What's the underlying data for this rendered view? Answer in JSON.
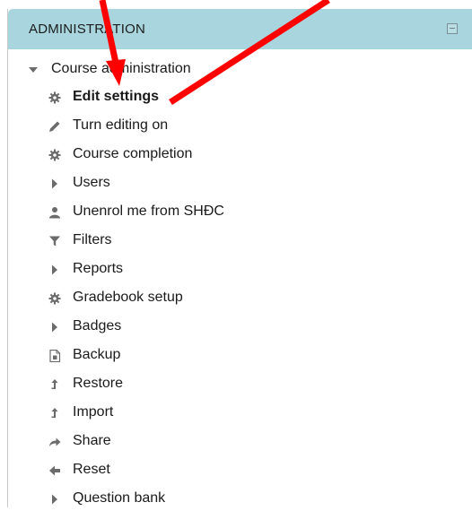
{
  "block": {
    "title": "ADMINISTRATION",
    "root_label": "Course administration"
  },
  "items": [
    {
      "label": "Edit settings",
      "icon": "gear-icon"
    },
    {
      "label": "Turn editing on",
      "icon": "pencil-icon"
    },
    {
      "label": "Course completion",
      "icon": "gear-icon"
    },
    {
      "label": "Users",
      "icon": "caret-right-icon"
    },
    {
      "label": "Unenrol me from SHĐC",
      "icon": "user-icon"
    },
    {
      "label": "Filters",
      "icon": "filter-icon"
    },
    {
      "label": "Reports",
      "icon": "caret-right-icon"
    },
    {
      "label": "Gradebook setup",
      "icon": "gear-icon"
    },
    {
      "label": "Badges",
      "icon": "caret-right-icon"
    },
    {
      "label": "Backup",
      "icon": "file-icon"
    },
    {
      "label": "Restore",
      "icon": "upload-icon"
    },
    {
      "label": "Import",
      "icon": "upload-icon"
    },
    {
      "label": "Share",
      "icon": "share-icon"
    },
    {
      "label": "Reset",
      "icon": "arrow-left-icon"
    },
    {
      "label": "Question bank",
      "icon": "caret-right-icon"
    }
  ],
  "colors": {
    "header_bg": "#a8d5de",
    "icon": "#6b6b6b",
    "annotation_arrow": "#ff0000"
  }
}
